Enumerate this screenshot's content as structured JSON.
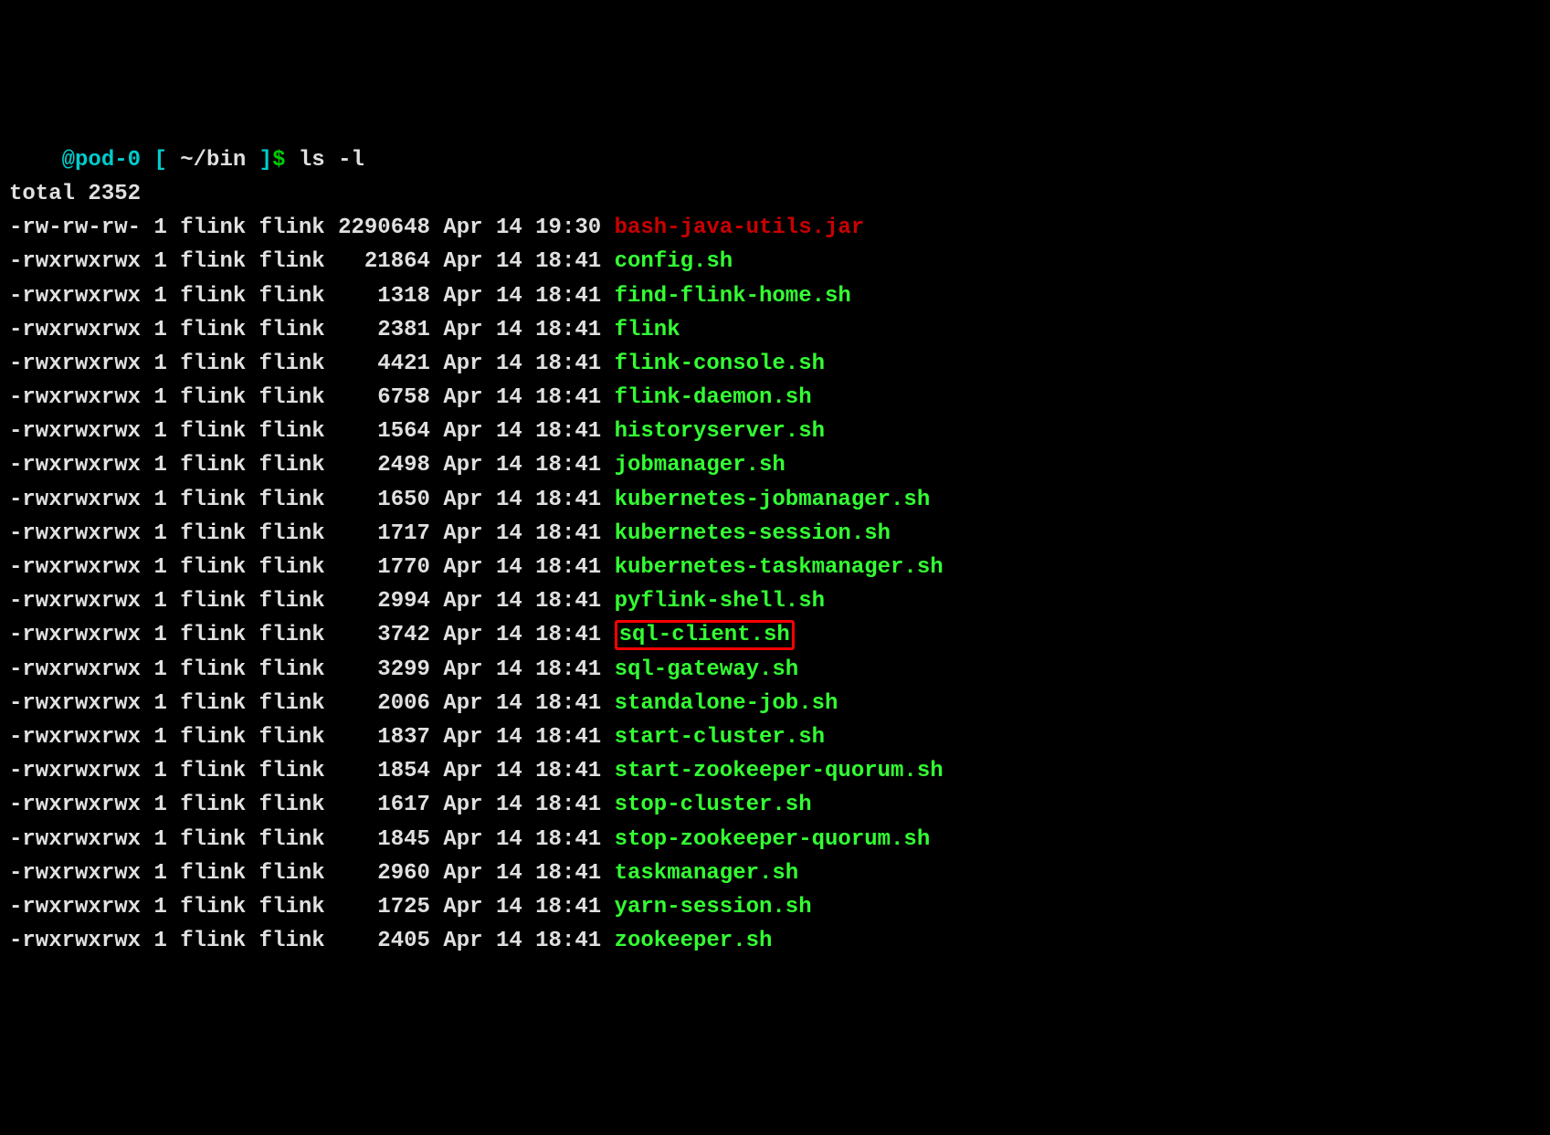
{
  "prompt": {
    "hostname": "@pod-0",
    "open_bracket": "[",
    "path": "~/bin",
    "close_bracket": "]",
    "dollar": "$",
    "command": "ls -l"
  },
  "total_line": "total 2352",
  "rows": [
    {
      "perms": "-rw-rw-rw-",
      "links": "1",
      "owner": "flink",
      "group": "flink",
      "size": "2290648",
      "month": "Apr",
      "day": "14",
      "time": "19:30",
      "name": "bash-java-utils.jar",
      "ftype": "file",
      "hl": false
    },
    {
      "perms": "-rwxrwxrwx",
      "links": "1",
      "owner": "flink",
      "group": "flink",
      "size": "21864",
      "month": "Apr",
      "day": "14",
      "time": "18:41",
      "name": "config.sh",
      "ftype": "exec",
      "hl": false
    },
    {
      "perms": "-rwxrwxrwx",
      "links": "1",
      "owner": "flink",
      "group": "flink",
      "size": "1318",
      "month": "Apr",
      "day": "14",
      "time": "18:41",
      "name": "find-flink-home.sh",
      "ftype": "exec",
      "hl": false
    },
    {
      "perms": "-rwxrwxrwx",
      "links": "1",
      "owner": "flink",
      "group": "flink",
      "size": "2381",
      "month": "Apr",
      "day": "14",
      "time": "18:41",
      "name": "flink",
      "ftype": "exec",
      "hl": false
    },
    {
      "perms": "-rwxrwxrwx",
      "links": "1",
      "owner": "flink",
      "group": "flink",
      "size": "4421",
      "month": "Apr",
      "day": "14",
      "time": "18:41",
      "name": "flink-console.sh",
      "ftype": "exec",
      "hl": false
    },
    {
      "perms": "-rwxrwxrwx",
      "links": "1",
      "owner": "flink",
      "group": "flink",
      "size": "6758",
      "month": "Apr",
      "day": "14",
      "time": "18:41",
      "name": "flink-daemon.sh",
      "ftype": "exec",
      "hl": false
    },
    {
      "perms": "-rwxrwxrwx",
      "links": "1",
      "owner": "flink",
      "group": "flink",
      "size": "1564",
      "month": "Apr",
      "day": "14",
      "time": "18:41",
      "name": "historyserver.sh",
      "ftype": "exec",
      "hl": false
    },
    {
      "perms": "-rwxrwxrwx",
      "links": "1",
      "owner": "flink",
      "group": "flink",
      "size": "2498",
      "month": "Apr",
      "day": "14",
      "time": "18:41",
      "name": "jobmanager.sh",
      "ftype": "exec",
      "hl": false
    },
    {
      "perms": "-rwxrwxrwx",
      "links": "1",
      "owner": "flink",
      "group": "flink",
      "size": "1650",
      "month": "Apr",
      "day": "14",
      "time": "18:41",
      "name": "kubernetes-jobmanager.sh",
      "ftype": "exec",
      "hl": false
    },
    {
      "perms": "-rwxrwxrwx",
      "links": "1",
      "owner": "flink",
      "group": "flink",
      "size": "1717",
      "month": "Apr",
      "day": "14",
      "time": "18:41",
      "name": "kubernetes-session.sh",
      "ftype": "exec",
      "hl": false
    },
    {
      "perms": "-rwxrwxrwx",
      "links": "1",
      "owner": "flink",
      "group": "flink",
      "size": "1770",
      "month": "Apr",
      "day": "14",
      "time": "18:41",
      "name": "kubernetes-taskmanager.sh",
      "ftype": "exec",
      "hl": false
    },
    {
      "perms": "-rwxrwxrwx",
      "links": "1",
      "owner": "flink",
      "group": "flink",
      "size": "2994",
      "month": "Apr",
      "day": "14",
      "time": "18:41",
      "name": "pyflink-shell.sh",
      "ftype": "exec",
      "hl": false
    },
    {
      "perms": "-rwxrwxrwx",
      "links": "1",
      "owner": "flink",
      "group": "flink",
      "size": "3742",
      "month": "Apr",
      "day": "14",
      "time": "18:41",
      "name": "sql-client.sh",
      "ftype": "exec",
      "hl": true
    },
    {
      "perms": "-rwxrwxrwx",
      "links": "1",
      "owner": "flink",
      "group": "flink",
      "size": "3299",
      "month": "Apr",
      "day": "14",
      "time": "18:41",
      "name": "sql-gateway.sh",
      "ftype": "exec",
      "hl": false
    },
    {
      "perms": "-rwxrwxrwx",
      "links": "1",
      "owner": "flink",
      "group": "flink",
      "size": "2006",
      "month": "Apr",
      "day": "14",
      "time": "18:41",
      "name": "standalone-job.sh",
      "ftype": "exec",
      "hl": false
    },
    {
      "perms": "-rwxrwxrwx",
      "links": "1",
      "owner": "flink",
      "group": "flink",
      "size": "1837",
      "month": "Apr",
      "day": "14",
      "time": "18:41",
      "name": "start-cluster.sh",
      "ftype": "exec",
      "hl": false
    },
    {
      "perms": "-rwxrwxrwx",
      "links": "1",
      "owner": "flink",
      "group": "flink",
      "size": "1854",
      "month": "Apr",
      "day": "14",
      "time": "18:41",
      "name": "start-zookeeper-quorum.sh",
      "ftype": "exec",
      "hl": false
    },
    {
      "perms": "-rwxrwxrwx",
      "links": "1",
      "owner": "flink",
      "group": "flink",
      "size": "1617",
      "month": "Apr",
      "day": "14",
      "time": "18:41",
      "name": "stop-cluster.sh",
      "ftype": "exec",
      "hl": false
    },
    {
      "perms": "-rwxrwxrwx",
      "links": "1",
      "owner": "flink",
      "group": "flink",
      "size": "1845",
      "month": "Apr",
      "day": "14",
      "time": "18:41",
      "name": "stop-zookeeper-quorum.sh",
      "ftype": "exec",
      "hl": false
    },
    {
      "perms": "-rwxrwxrwx",
      "links": "1",
      "owner": "flink",
      "group": "flink",
      "size": "2960",
      "month": "Apr",
      "day": "14",
      "time": "18:41",
      "name": "taskmanager.sh",
      "ftype": "exec",
      "hl": false
    },
    {
      "perms": "-rwxrwxrwx",
      "links": "1",
      "owner": "flink",
      "group": "flink",
      "size": "1725",
      "month": "Apr",
      "day": "14",
      "time": "18:41",
      "name": "yarn-session.sh",
      "ftype": "exec",
      "hl": false
    },
    {
      "perms": "-rwxrwxrwx",
      "links": "1",
      "owner": "flink",
      "group": "flink",
      "size": "2405",
      "month": "Apr",
      "day": "14",
      "time": "18:41",
      "name": "zookeeper.sh",
      "ftype": "exec",
      "hl": false
    }
  ]
}
